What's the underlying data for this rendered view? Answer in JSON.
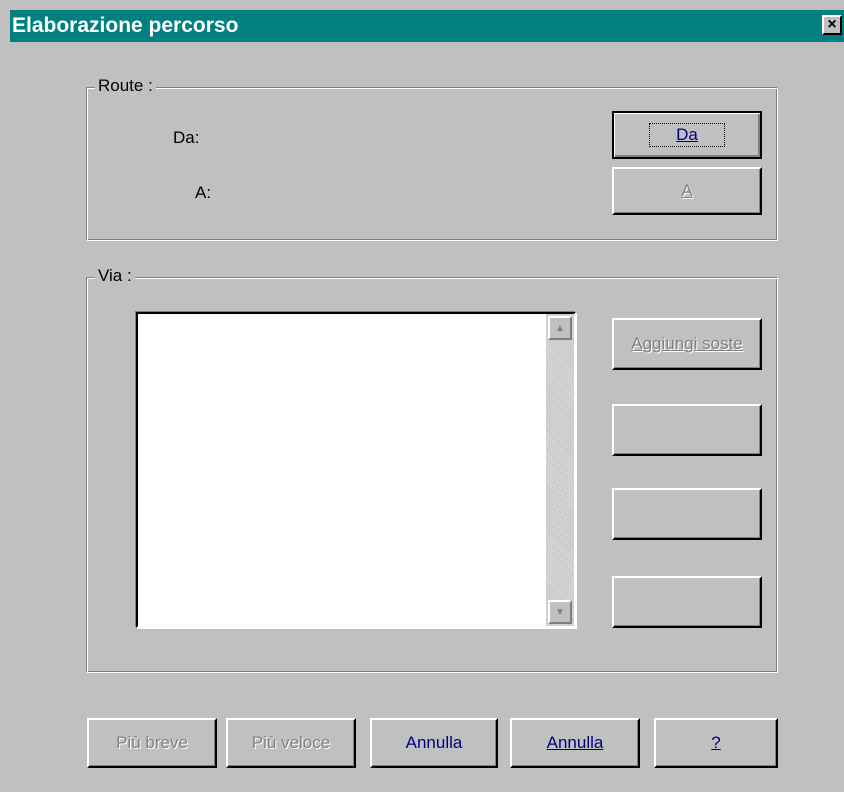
{
  "window": {
    "title": "Elaborazione percorso",
    "close_glyph": "×"
  },
  "route": {
    "group_label": "Route :",
    "from_label": "Da:",
    "to_label": "A:",
    "from_button": "Da",
    "to_button": "A"
  },
  "via": {
    "group_label": "Via :",
    "add_stops_button": "Aggiungi soste",
    "blank_button_1": "",
    "blank_button_2": "",
    "blank_button_3": "",
    "scroll_up_glyph": "▲",
    "scroll_down_glyph": "▼"
  },
  "footer": {
    "shortest_button": "Più breve",
    "fastest_button": "Più veloce",
    "cancel_button_1": "Annulla",
    "cancel_button_2": "Annulla",
    "help_button": "?"
  },
  "colors": {
    "titlebar": "#008080",
    "face": "#c0c0c0",
    "button_text": "#00007f",
    "disabled_text": "#808080"
  }
}
